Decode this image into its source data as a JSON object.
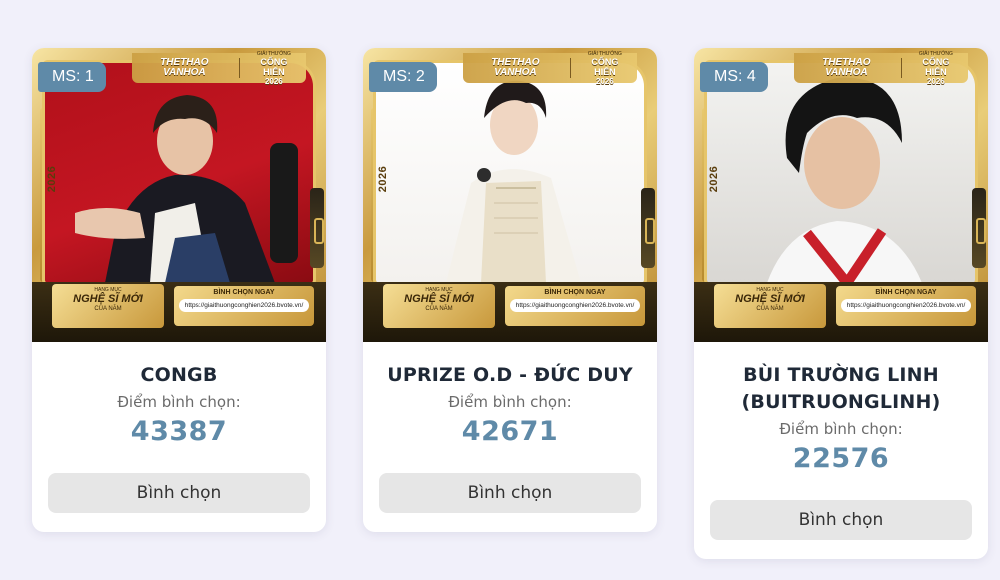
{
  "cards": [
    {
      "ms": "MS: 1",
      "name": "CONGB",
      "score_label": "Điểm bình chọn:",
      "score": "43387",
      "button": "Bình chọn"
    },
    {
      "ms": "MS: 2",
      "name": "UPRIZE O.D - ĐỨC DUY",
      "score_label": "Điểm bình chọn:",
      "score": "42671",
      "button": "Bình chọn"
    },
    {
      "ms": "MS: 4",
      "name": "BÙI TRƯỜNG LINH (BUITRUONGLINH)",
      "score_label": "Điểm bình chọn:",
      "score": "22576",
      "button": "Bình chọn"
    }
  ],
  "poster": {
    "logo": "THETHAO VANHOA",
    "award_top": "GIẢI THƯỞNG",
    "award_mid": "CỐNG HIẾN",
    "award_year": "2026",
    "year": "2026",
    "category_small": "HẠNG MỤC",
    "category_main": "NGHỆ SĨ MỚI",
    "category_sub": "CỦA NĂM",
    "vote_now": "BÌNH CHỌN NGAY",
    "url": "https://giaithuongconghien2026.bvote.vn/"
  },
  "colors": {
    "accent": "#5f8aa8",
    "background": "#f1f0fa",
    "button_bg": "#e6e6e6"
  }
}
